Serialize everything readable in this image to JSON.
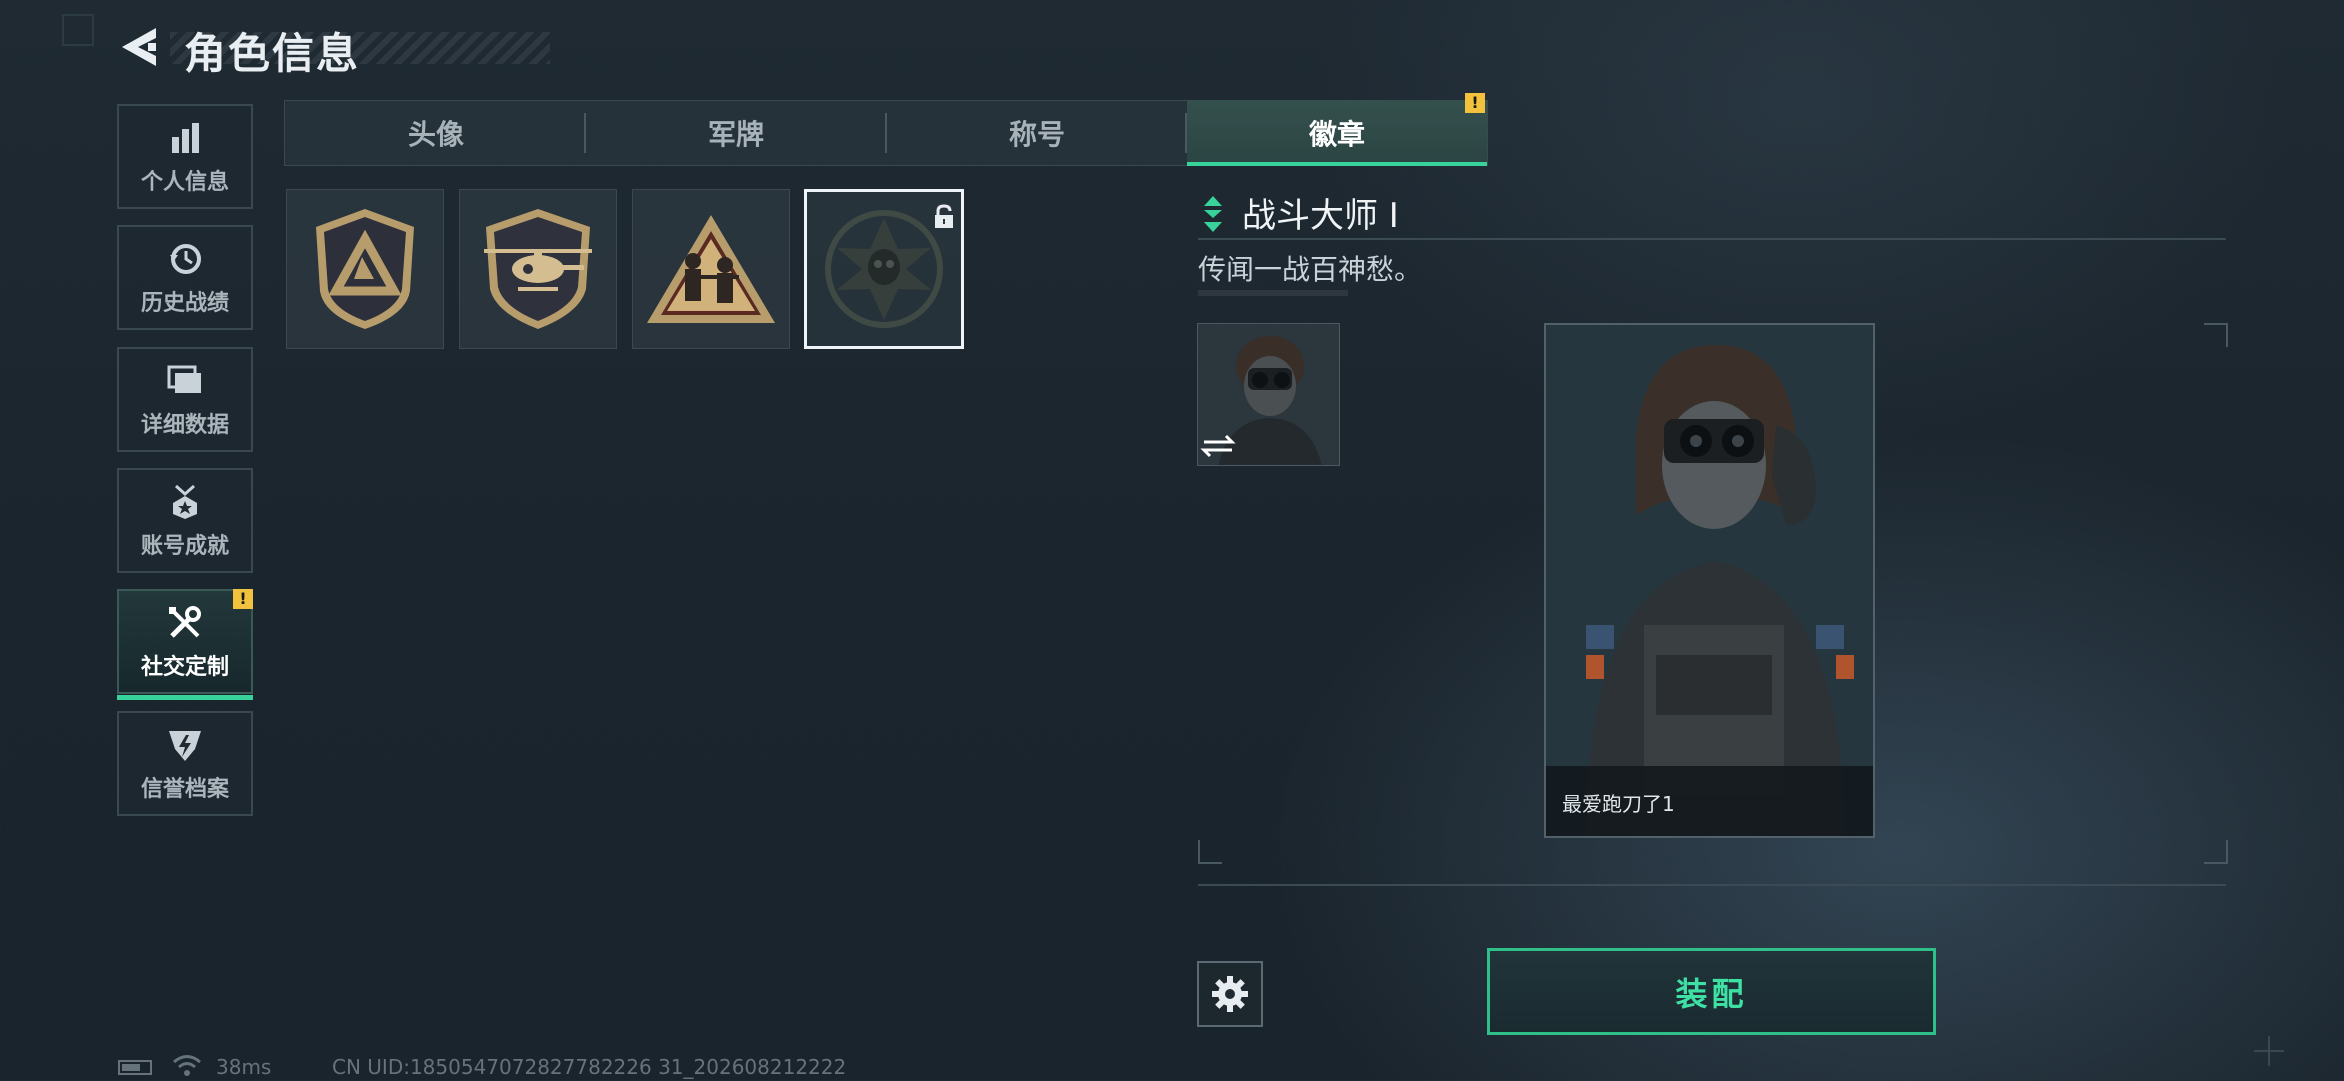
{
  "header": {
    "title": "角色信息"
  },
  "sidebar": {
    "items": [
      {
        "label": "个人信息",
        "icon": "bar-chart-icon"
      },
      {
        "label": "历史战绩",
        "icon": "clock-icon"
      },
      {
        "label": "详细数据",
        "icon": "folder-icon"
      },
      {
        "label": "账号成就",
        "icon": "medal-icon"
      },
      {
        "label": "社交定制",
        "icon": "tools-icon",
        "active": true,
        "badge": "!"
      },
      {
        "label": "信誉档案",
        "icon": "shield-bolt-icon"
      }
    ]
  },
  "tabs": {
    "items": [
      {
        "label": "头像"
      },
      {
        "label": "军牌"
      },
      {
        "label": "称号"
      },
      {
        "label": "徽章",
        "active": true,
        "badge": "!"
      }
    ]
  },
  "badges": [
    {
      "icon": "triangle-shield-badge-icon",
      "selected": false,
      "locked": false
    },
    {
      "icon": "helicopter-badge-icon",
      "selected": false,
      "locked": false
    },
    {
      "icon": "soldiers-badge-icon",
      "selected": false,
      "locked": false
    },
    {
      "icon": "skull-star-badge-icon",
      "selected": true,
      "locked": true
    }
  ],
  "detail": {
    "name": "战斗大师 I",
    "description": "传闻一战百神愁。",
    "preview_player_name": "最爱跑刀了1",
    "equip_label": "装配"
  },
  "status_bar": {
    "ping": "38ms",
    "uid": "CN UID:1850547072827782226 31_202608212222"
  },
  "colors": {
    "accent": "#37d39a",
    "warning": "#f2c23e"
  }
}
